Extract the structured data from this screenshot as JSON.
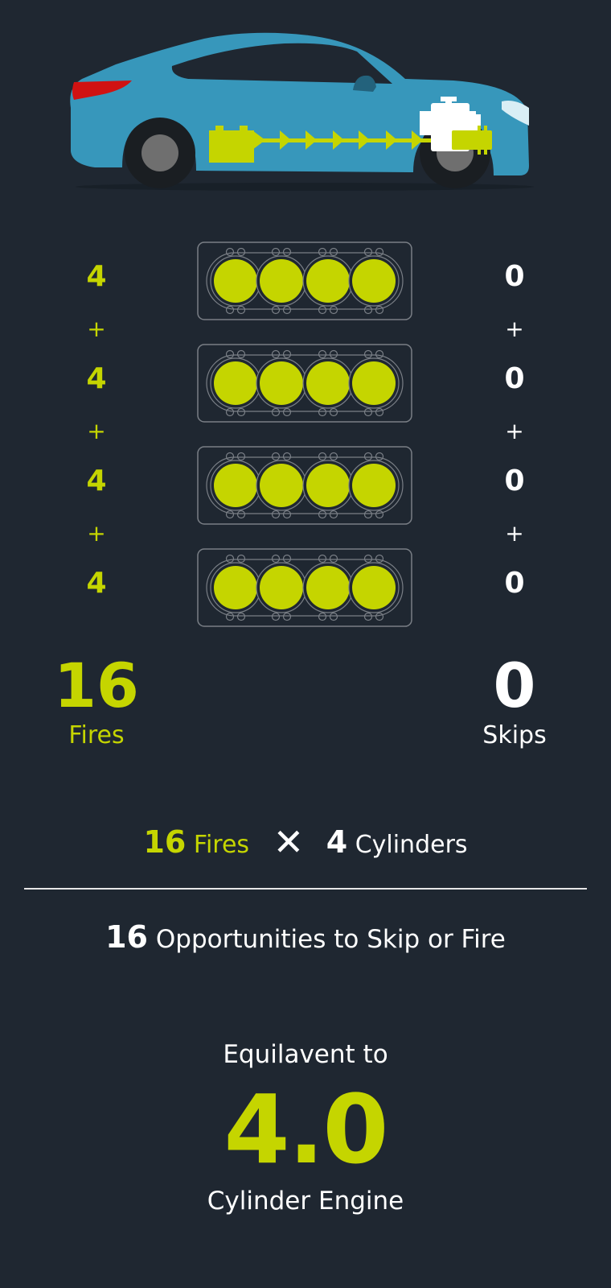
{
  "colors": {
    "background": "#1f2731",
    "accent": "#c5d500",
    "car_body": "#3797bb",
    "tail_light": "#d01212",
    "text": "#ffffff"
  },
  "rows": [
    {
      "fires": "4",
      "skips": "0",
      "cylinders_firing": 4
    },
    {
      "fires": "4",
      "skips": "0",
      "cylinders_firing": 4
    },
    {
      "fires": "4",
      "skips": "0",
      "cylinders_firing": 4
    },
    {
      "fires": "4",
      "skips": "0",
      "cylinders_firing": 4
    }
  ],
  "operator_plus": "+",
  "totals": {
    "fires_value": "16",
    "fires_label": "Fires",
    "skips_value": "0",
    "skips_label": "Skips"
  },
  "equation": {
    "fires_value": "16",
    "fires_label": "Fires",
    "times_symbol": "✕",
    "cylinders_value": "4",
    "cylinders_label": "Cylinders"
  },
  "result": {
    "value": "16",
    "label": "Opportunities to Skip or Fire"
  },
  "equivalent": {
    "prefix": "Equilavent to",
    "value": "4.0",
    "suffix": "Cylinder Engine"
  }
}
